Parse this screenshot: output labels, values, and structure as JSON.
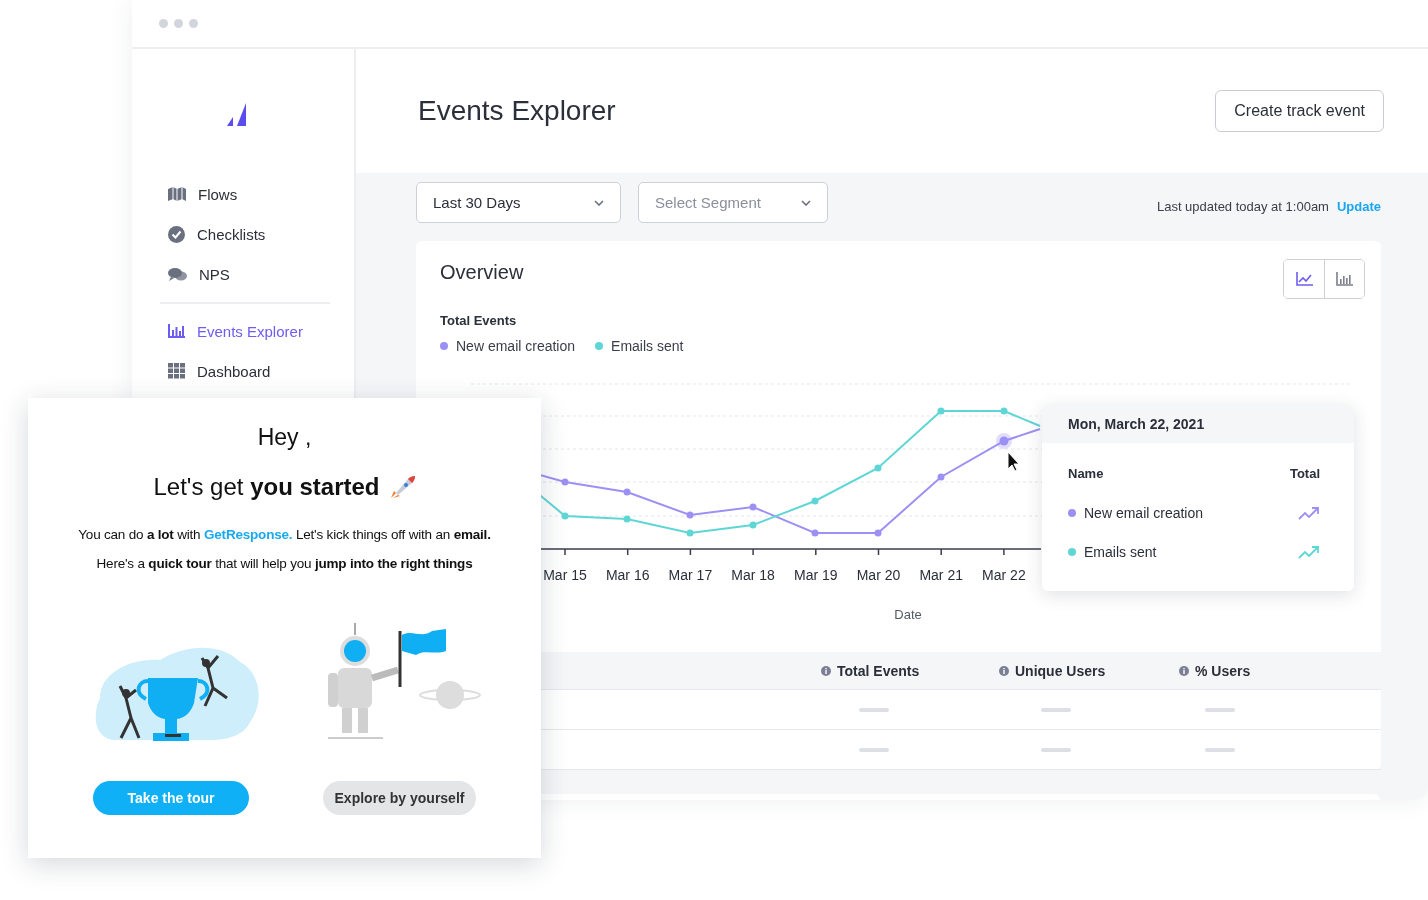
{
  "sidebar": {
    "sections": [
      {
        "items": [
          {
            "label": "Flows",
            "selected": false
          },
          {
            "label": "Checklists",
            "selected": false
          },
          {
            "label": "NPS",
            "selected": false
          }
        ]
      },
      {
        "items": [
          {
            "label": "Events Explorer",
            "selected": true
          },
          {
            "label": "Dashboard",
            "selected": false
          }
        ]
      }
    ]
  },
  "header": {
    "title": "Events Explorer",
    "button": "Create track event"
  },
  "filters": [
    {
      "value": "Last 30 Days"
    },
    {
      "placeholder": "Select Segment"
    }
  ],
  "last_updated": {
    "text": "Last updated today at 1:00am",
    "link": "Update"
  },
  "overview": {
    "title": "Overview",
    "view_toggle": [
      {
        "kind": "line",
        "selected": true
      },
      {
        "kind": "bar",
        "selected": false
      }
    ],
    "subtitle": "Total Events",
    "legend": [
      {
        "label": "New email creation",
        "color": "#9d90f5"
      },
      {
        "label": "Emails sent",
        "color": "#5fd6d6"
      }
    ],
    "x_labels": [
      "Mar 15",
      "Mar 16",
      "Mar 17",
      "Mar 18",
      "Mar 19",
      "Mar 20",
      "Mar 21",
      "Mar 22"
    ],
    "x_axis_title": "Date",
    "tooltip": {
      "date": "Mon, March 22, 2021",
      "columns": [
        "Name",
        "Total"
      ],
      "rows": [
        {
          "label": "New email creation",
          "color": "#9d90f5"
        },
        {
          "label": "Emails sent",
          "color": "#5fd6d6"
        }
      ]
    }
  },
  "table": {
    "columns": [
      "Total Events",
      "Unique Users",
      "% Users"
    ],
    "rows": [
      {
        "loading": true
      },
      {
        "loading": true
      }
    ]
  },
  "modal": {
    "greeting": "Hey ,",
    "title": "Let's get **you started**",
    "line_1": {
      "before": "You can do **a lot** with",
      "link": "GetResponse.",
      "after": "Let's kick things off with an **email.**"
    },
    "line_2": "Here's a **quick tour** that will help you **jump into the right things**",
    "buttons": [
      {
        "label": "Take the tour",
        "kind": "primary"
      },
      {
        "label": "Explore by yourself",
        "kind": "secondary"
      }
    ]
  }
}
